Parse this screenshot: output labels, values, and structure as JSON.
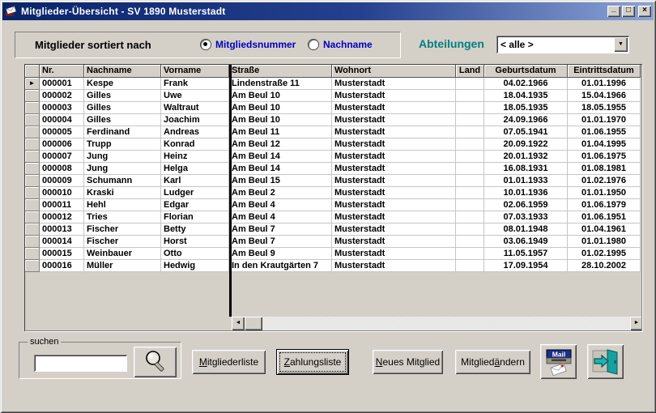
{
  "window": {
    "title": "Mitglieder-Übersicht - SV 1890 Musterstadt",
    "controls": {
      "minimize": "_",
      "maximize": "□",
      "close": "×"
    }
  },
  "colors": {
    "titlebar_start": "#0a246a",
    "titlebar_end": "#8ca4d6",
    "accent_blue": "#0000bf",
    "accent_teal": "#008080",
    "window_face": "#d4d0c8"
  },
  "sort_panel": {
    "label": "Mitglieder sortiert nach",
    "options": [
      {
        "label": "Mitgliedsnummer",
        "selected": true
      },
      {
        "label": "Nachname",
        "selected": false
      }
    ]
  },
  "abteilungen": {
    "label": "Abteilungen",
    "value": "< alle >"
  },
  "icons": {
    "record_pointer": "►",
    "scroll_left": "◄",
    "scroll_right": "►",
    "dropdown_arrow": "▼",
    "mail_text": "Mail"
  },
  "grid": {
    "pointer_row": 0,
    "columns": [
      {
        "key": "selector",
        "label": ""
      },
      {
        "key": "nr",
        "label": "Nr."
      },
      {
        "key": "nachname",
        "label": "Nachname"
      },
      {
        "key": "vorname",
        "label": "Vorname"
      },
      {
        "key": "strasse",
        "label": "Straße"
      },
      {
        "key": "wohnort",
        "label": "Wohnort"
      },
      {
        "key": "land",
        "label": "Land"
      },
      {
        "key": "geburtsdatum",
        "label": "Geburtsdatum"
      },
      {
        "key": "eintrittsdatum",
        "label": "Eintrittsdatum"
      }
    ],
    "rows": [
      [
        "000001",
        "Kespe",
        "Frank",
        "Lindenstraße 11",
        "Musterstadt",
        "",
        "04.02.1966",
        "01.01.1996"
      ],
      [
        "000002",
        "Gilles",
        "Uwe",
        "Am Beul 10",
        "Musterstadt",
        "",
        "18.04.1935",
        "15.04.1966"
      ],
      [
        "000003",
        "Gilles",
        "Waltraut",
        "Am Beul 10",
        "Musterstadt",
        "",
        "18.05.1935",
        "18.05.1955"
      ],
      [
        "000004",
        "Gilles",
        "Joachim",
        "Am Beul 10",
        "Musterstadt",
        "",
        "24.09.1966",
        "01.01.1970"
      ],
      [
        "000005",
        "Ferdinand",
        "Andreas",
        "Am Beul 11",
        "Musterstadt",
        "",
        "07.05.1941",
        "01.06.1955"
      ],
      [
        "000006",
        "Trupp",
        "Konrad",
        "Am Beul 12",
        "Musterstadt",
        "",
        "20.09.1922",
        "01.04.1995"
      ],
      [
        "000007",
        "Jung",
        "Heinz",
        "Am Beul 14",
        "Musterstadt",
        "",
        "20.01.1932",
        "01.06.1975"
      ],
      [
        "000008",
        "Jung",
        "Helga",
        "Am Beul 14",
        "Musterstadt",
        "",
        "16.08.1931",
        "01.08.1981"
      ],
      [
        "000009",
        "Schumann",
        "Karl",
        "Am Beul 15",
        "Musterstadt",
        "",
        "01.01.1933",
        "01.02.1976"
      ],
      [
        "000010",
        "Kraski",
        "Ludger",
        "Am Beul 2",
        "Musterstadt",
        "",
        "10.01.1936",
        "01.01.1950"
      ],
      [
        "000011",
        "Hehl",
        "Edgar",
        "Am Beul 4",
        "Musterstadt",
        "",
        "02.06.1959",
        "01.06.1979"
      ],
      [
        "000012",
        "Tries",
        "Florian",
        "Am Beul 4",
        "Musterstadt",
        "",
        "07.03.1933",
        "01.06.1951"
      ],
      [
        "000013",
        "Fischer",
        "Betty",
        "Am Beul 7",
        "Musterstadt",
        "",
        "08.01.1948",
        "01.04.1961"
      ],
      [
        "000014",
        "Fischer",
        "Horst",
        "Am Beul 7",
        "Musterstadt",
        "",
        "03.06.1949",
        "01.01.1980"
      ],
      [
        "000015",
        "Weinbauer",
        "Otto",
        "Am Beul 9",
        "Musterstadt",
        "",
        "11.05.1957",
        "01.02.1995"
      ],
      [
        "000016",
        "Müller",
        "Hedwig",
        "In den Krautgärten 7",
        "Musterstadt",
        "",
        "17.09.1954",
        "28.10.2002"
      ]
    ]
  },
  "search": {
    "group_label": "suchen",
    "input_value": "",
    "input_placeholder": ""
  },
  "buttons": {
    "mitgliederliste": {
      "label": "Mitgliederliste",
      "label_html": "<u>M</u>itgliederliste"
    },
    "zahlungsliste": {
      "label": "Zahlungsliste",
      "label_html": "<u>Z</u>ahlungsliste"
    },
    "neues_mitglied": {
      "label": "Neues Mitglied",
      "label_html": "<u>N</u>eues Mitglied"
    },
    "mitglied_aendern": {
      "label": "Mitglied ändern",
      "label_html": "Mitglied <u>ä</u>ndern"
    }
  }
}
